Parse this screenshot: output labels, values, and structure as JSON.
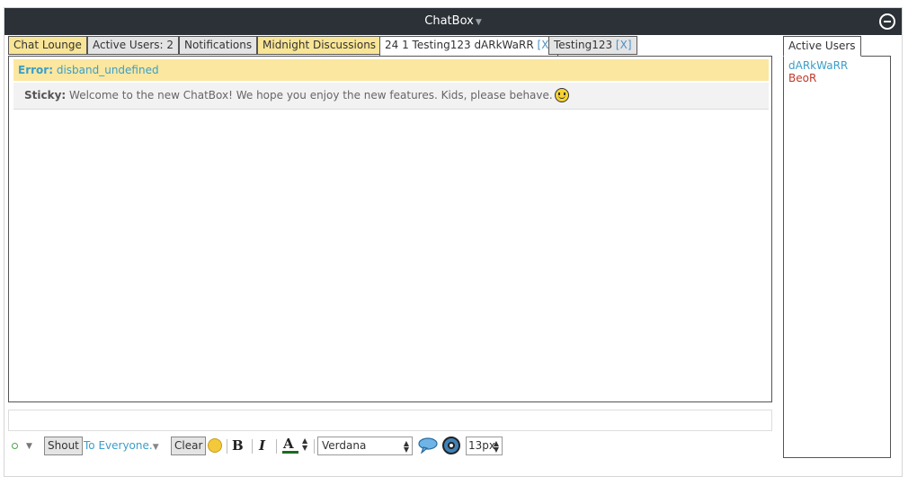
{
  "window": {
    "title": "ChatBox"
  },
  "tabs": [
    {
      "label": "Chat Lounge"
    },
    {
      "label": "Active Users: 2"
    },
    {
      "label": "Notifications"
    },
    {
      "label": "Midnight Discussions"
    },
    {
      "label": "24 1 Testing123 dARkWaRR",
      "close": "[X]"
    },
    {
      "label": "Testing123",
      "close": "[X]"
    }
  ],
  "messages": {
    "error_label": "Error:",
    "error_text": "disband_undefined",
    "sticky_label": "Sticky:",
    "sticky_text": "Welcome to the new ChatBox! We hope you enjoy the new features. Kids, please behave."
  },
  "toolbar": {
    "shout_label": "Shout",
    "recipient": "To Everyone.",
    "clear_label": "Clear",
    "bold": "B",
    "italic": "I",
    "color_letter": "A",
    "font": "Verdana",
    "size": "13px"
  },
  "users": {
    "tab_label": "Active Users",
    "list": [
      {
        "name": "dARkWaRR",
        "color": "#3b9ec9"
      },
      {
        "name": "BeoR",
        "color": "#c0392b"
      }
    ]
  },
  "colors": {
    "accent": "#3b9ec9",
    "titlebar": "#2b3136",
    "tab_highlight": "#f9e596"
  },
  "icons": [
    "collapse-icon",
    "smiley-icon",
    "status-icon",
    "emoji-icon",
    "speech-bubble-icon",
    "eye-icon"
  ]
}
